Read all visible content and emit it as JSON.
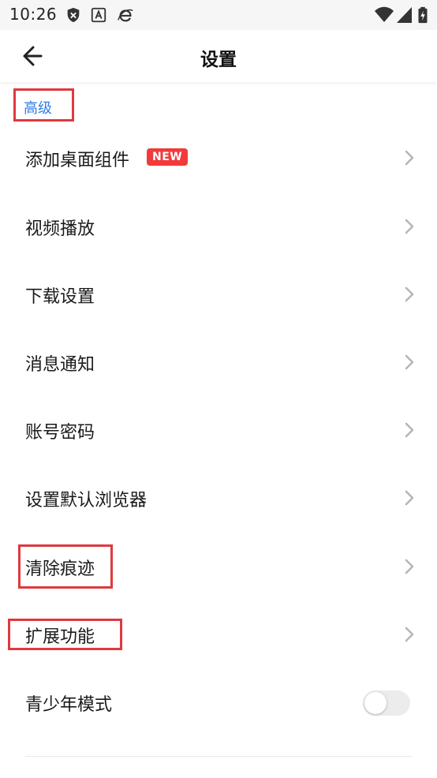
{
  "status_bar": {
    "time": "10:26",
    "icons": [
      "shield-icon",
      "font-a-icon",
      "browser-e-icon",
      "wifi-icon",
      "signal-icon",
      "battery-charging-icon"
    ]
  },
  "header": {
    "title": "设置"
  },
  "section": {
    "label": "高级"
  },
  "list": {
    "items": [
      {
        "label": "添加桌面组件",
        "badge": "NEW"
      },
      {
        "label": "视频播放"
      },
      {
        "label": "下载设置"
      },
      {
        "label": "消息通知"
      },
      {
        "label": "账号密码"
      },
      {
        "label": "设置默认浏览器"
      },
      {
        "label": "清除痕迹"
      },
      {
        "label": "扩展功能"
      },
      {
        "label": "青少年模式",
        "toggle": false
      }
    ]
  },
  "colors": {
    "accent": "#2f7ee6",
    "badge": "#f13a3a",
    "highlight": "#e0393e"
  }
}
